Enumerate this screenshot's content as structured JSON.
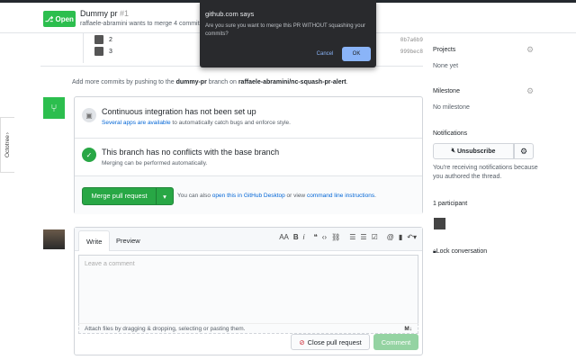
{
  "header": {
    "status": "Open",
    "title": "Dummy pr",
    "number": "#1",
    "subtitle": "raffaele-abramini wants to merge 4 commits"
  },
  "commits": [
    {
      "label": "2",
      "sha": "0b7a6b9"
    },
    {
      "label": "3",
      "sha": "999bec8"
    }
  ],
  "add_more": {
    "prefix": "Add more commits by pushing to the ",
    "branch": "dummy-pr",
    "middle": " branch on ",
    "repo": "raffaele-abramini/nc-squash-pr-alert",
    "suffix": "."
  },
  "merge": {
    "ci_title": "Continuous integration has not been set up",
    "ci_link": "Several apps are available",
    "ci_rest": " to automatically catch bugs and enforce style.",
    "conflict_title": "This branch has no conflicts with the base branch",
    "conflict_sub": "Merging can be performed automatically.",
    "merge_button": "Merge pull request",
    "hint_prefix": "You can also ",
    "hint_link1": "open this in GitHub Desktop",
    "hint_mid": " or view ",
    "hint_link2": "command line instructions",
    "hint_suffix": "."
  },
  "sidebar": {
    "projects": "Projects",
    "projects_value": "None yet",
    "milestone": "Milestone",
    "milestone_value": "No milestone",
    "notifications": "Notifications",
    "unsubscribe": "Unsubscribe",
    "notif_text": "You're receiving notifications because you authored the thread.",
    "participants": "1 participant",
    "lock": "Lock conversation"
  },
  "octotree": "Octotree",
  "comment": {
    "tab_write": "Write",
    "tab_preview": "Preview",
    "placeholder": "Leave a comment",
    "attach": "Attach files by dragging & dropping, selecting or pasting them.",
    "close_button": "Close pull request",
    "comment_button": "Comment"
  },
  "dialog": {
    "title": "github.com says",
    "message": "Are you sure you want to merge this PR WITHOUT squashing your commits?",
    "cancel": "Cancel",
    "ok": "OK"
  }
}
